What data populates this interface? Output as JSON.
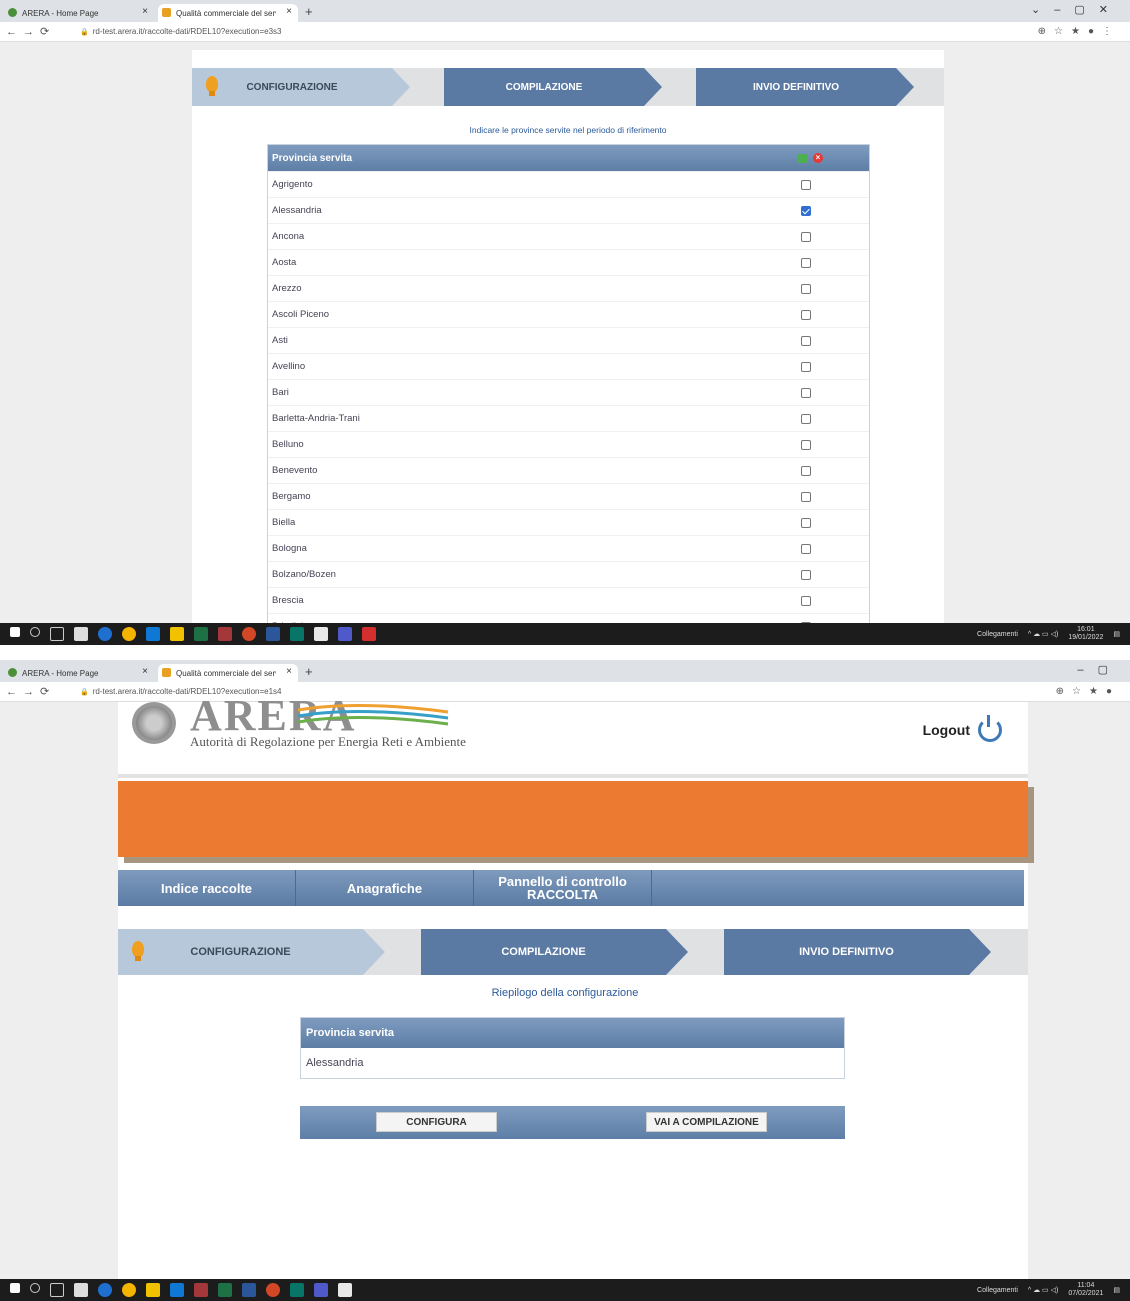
{
  "shot1": {
    "tabs": [
      {
        "label": "ARERA - Home Page"
      },
      {
        "label": "Qualità commerciale del servizio"
      }
    ],
    "url": "rd-test.arera.it/raccolte-dati/RDEL10?execution=e3s3",
    "steps": {
      "configurazione": "CONFIGURAZIONE",
      "compilazione": "COMPILAZIONE",
      "invio": "INVIO DEFINITIVO"
    },
    "instruction": "Indicare le province servite nel periodo di riferimento",
    "table_header": "Provincia servita",
    "rows": [
      {
        "name": "Agrigento",
        "checked": false
      },
      {
        "name": "Alessandria",
        "checked": true
      },
      {
        "name": "Ancona",
        "checked": false
      },
      {
        "name": "Aosta",
        "checked": false
      },
      {
        "name": "Arezzo",
        "checked": false
      },
      {
        "name": "Ascoli Piceno",
        "checked": false
      },
      {
        "name": "Asti",
        "checked": false
      },
      {
        "name": "Avellino",
        "checked": false
      },
      {
        "name": "Bari",
        "checked": false
      },
      {
        "name": "Barletta-Andria-Trani",
        "checked": false
      },
      {
        "name": "Belluno",
        "checked": false
      },
      {
        "name": "Benevento",
        "checked": false
      },
      {
        "name": "Bergamo",
        "checked": false
      },
      {
        "name": "Biella",
        "checked": false
      },
      {
        "name": "Bologna",
        "checked": false
      },
      {
        "name": "Bolzano/Bozen",
        "checked": false
      },
      {
        "name": "Brescia",
        "checked": false
      },
      {
        "name": "Brindisi",
        "checked": false
      }
    ],
    "taskbar": {
      "links": "Collegamenti",
      "time": "16:01",
      "date": "19/01/2022"
    }
  },
  "shot2": {
    "tabs": [
      {
        "label": "ARERA - Home Page"
      },
      {
        "label": "Qualità commerciale del servizio"
      }
    ],
    "url": "rd-test.arera.it/raccolte-dati/RDEL10?execution=e1s4",
    "logo_text": "ARERA",
    "logo_subtitle": "Autorità di Regolazione per Energia Reti e Ambiente",
    "logout": "Logout",
    "menu": {
      "indice": "Indice raccolte",
      "anagrafiche": "Anagrafiche",
      "pannello_line1": "Pannello di controllo",
      "pannello_line2": "RACCOLTA"
    },
    "steps": {
      "configurazione": "CONFIGURAZIONE",
      "compilazione": "COMPILAZIONE",
      "invio": "INVIO DEFINITIVO"
    },
    "summary_title": "Riepilogo della configurazione",
    "summary_header": "Provincia servita",
    "summary_rows": [
      "Alessandria"
    ],
    "buttons": {
      "configura": "CONFIGURA",
      "vai": "VAI A COMPILAZIONE"
    },
    "taskbar": {
      "links": "Collegamenti",
      "time": "11:04",
      "date": "07/02/2021"
    }
  },
  "colors": {
    "step_active": "#5b7aa3",
    "step_done": "#b8c8db",
    "banner": "#ec7a30",
    "accent": "#2f6fd0"
  }
}
